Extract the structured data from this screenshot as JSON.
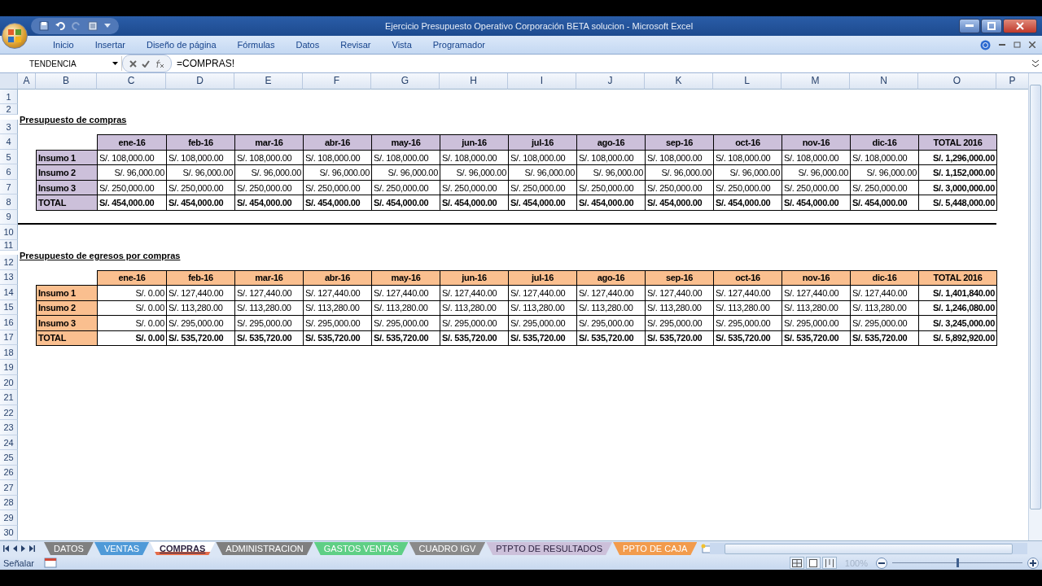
{
  "window": {
    "title": "Ejercicio Presupuesto Operativo Corporación BETA solucion - Microsoft Excel"
  },
  "ribbon_tabs": [
    "Inicio",
    "Insertar",
    "Diseño de página",
    "Fórmulas",
    "Datos",
    "Revisar",
    "Vista",
    "Programador"
  ],
  "formula_bar": {
    "name_box": "TENDENCIA",
    "formula": "=COMPRAS!"
  },
  "column_headers": [
    "A",
    "B",
    "C",
    "D",
    "E",
    "F",
    "G",
    "H",
    "I",
    "J",
    "K",
    "L",
    "M",
    "N",
    "O",
    "P"
  ],
  "row_numbers": [
    "1",
    "2",
    "3",
    "4",
    "5",
    "6",
    "7",
    "8",
    "9",
    "10",
    "11",
    "12",
    "13",
    "14",
    "15",
    "16",
    "17",
    "18",
    "19",
    "20",
    "21",
    "22",
    "23",
    "24",
    "25",
    "26",
    "27",
    "28",
    "29",
    "30"
  ],
  "tables": [
    {
      "title": "Presupuesto de compras",
      "color": "#ccc0da",
      "headers": [
        "ene-16",
        "feb-16",
        "mar-16",
        "abr-16",
        "may-16",
        "jun-16",
        "jul-16",
        "ago-16",
        "sep-16",
        "oct-16",
        "nov-16",
        "dic-16",
        "TOTAL 2016"
      ],
      "rows": [
        {
          "label": "Insumo 1",
          "values": [
            "S/. 108,000.00",
            "S/. 108,000.00",
            "S/. 108,000.00",
            "S/. 108,000.00",
            "S/. 108,000.00",
            "S/. 108,000.00",
            "S/. 108,000.00",
            "S/. 108,000.00",
            "S/. 108,000.00",
            "S/. 108,000.00",
            "S/. 108,000.00",
            "S/. 108,000.00"
          ],
          "total": "S/. 1,296,000.00"
        },
        {
          "label": "Insumo 2",
          "values": [
            "S/. 96,000.00",
            "S/. 96,000.00",
            "S/. 96,000.00",
            "S/. 96,000.00",
            "S/. 96,000.00",
            "S/. 96,000.00",
            "S/. 96,000.00",
            "S/. 96,000.00",
            "S/. 96,000.00",
            "S/. 96,000.00",
            "S/. 96,000.00",
            "S/. 96,000.00"
          ],
          "total": "S/. 1,152,000.00"
        },
        {
          "label": "Insumo 3",
          "values": [
            "S/. 250,000.00",
            "S/. 250,000.00",
            "S/. 250,000.00",
            "S/. 250,000.00",
            "S/. 250,000.00",
            "S/. 250,000.00",
            "S/. 250,000.00",
            "S/. 250,000.00",
            "S/. 250,000.00",
            "S/. 250,000.00",
            "S/. 250,000.00",
            "S/. 250,000.00"
          ],
          "total": "S/. 3,000,000.00"
        }
      ],
      "total_row": {
        "label": "TOTAL",
        "values": [
          "S/. 454,000.00",
          "S/. 454,000.00",
          "S/. 454,000.00",
          "S/. 454,000.00",
          "S/. 454,000.00",
          "S/. 454,000.00",
          "S/. 454,000.00",
          "S/. 454,000.00",
          "S/. 454,000.00",
          "S/. 454,000.00",
          "S/. 454,000.00",
          "S/. 454,000.00"
        ],
        "total": "S/. 5,448,000.00"
      }
    },
    {
      "title": "Presupuesto de egresos por compras",
      "color": "#fabf8f",
      "headers": [
        "ene-16",
        "feb-16",
        "mar-16",
        "abr-16",
        "may-16",
        "jun-16",
        "jul-16",
        "ago-16",
        "sep-16",
        "oct-16",
        "nov-16",
        "dic-16",
        "TOTAL 2016"
      ],
      "rows": [
        {
          "label": "Insumo 1",
          "values": [
            "S/. 0.00",
            "S/. 127,440.00",
            "S/. 127,440.00",
            "S/. 127,440.00",
            "S/. 127,440.00",
            "S/. 127,440.00",
            "S/. 127,440.00",
            "S/. 127,440.00",
            "S/. 127,440.00",
            "S/. 127,440.00",
            "S/. 127,440.00",
            "S/. 127,440.00"
          ],
          "total": "S/. 1,401,840.00"
        },
        {
          "label": "Insumo 2",
          "values": [
            "S/. 0.00",
            "S/. 113,280.00",
            "S/. 113,280.00",
            "S/. 113,280.00",
            "S/. 113,280.00",
            "S/. 113,280.00",
            "S/. 113,280.00",
            "S/. 113,280.00",
            "S/. 113,280.00",
            "S/. 113,280.00",
            "S/. 113,280.00",
            "S/. 113,280.00"
          ],
          "total": "S/. 1,246,080.00"
        },
        {
          "label": "Insumo 3",
          "values": [
            "S/. 0.00",
            "S/. 295,000.00",
            "S/. 295,000.00",
            "S/. 295,000.00",
            "S/. 295,000.00",
            "S/. 295,000.00",
            "S/. 295,000.00",
            "S/. 295,000.00",
            "S/. 295,000.00",
            "S/. 295,000.00",
            "S/. 295,000.00",
            "S/. 295,000.00"
          ],
          "total": "S/. 3,245,000.00"
        }
      ],
      "total_row": {
        "label": "TOTAL",
        "values": [
          "S/. 0.00",
          "S/. 535,720.00",
          "S/. 535,720.00",
          "S/. 535,720.00",
          "S/. 535,720.00",
          "S/. 535,720.00",
          "S/. 535,720.00",
          "S/. 535,720.00",
          "S/. 535,720.00",
          "S/. 535,720.00",
          "S/. 535,720.00",
          "S/. 535,720.00"
        ],
        "total": "S/. 5,892,920.00"
      }
    }
  ],
  "sheet_tabs": [
    {
      "label": "DATOS",
      "selected": false,
      "color": "#808080"
    },
    {
      "label": "VENTAS",
      "selected": false,
      "color": "#4f9ad8"
    },
    {
      "label": "COMPRAS",
      "selected": true,
      "color": "#e46c4a"
    },
    {
      "label": "ADMINISTRACION",
      "selected": false,
      "color": "#7f7f7f"
    },
    {
      "label": "GASTOS VENTAS",
      "selected": false,
      "color": "#5fcf85"
    },
    {
      "label": "CUADRO IGV",
      "selected": false,
      "color": "#8a8a8a"
    },
    {
      "label": "PTPTO DE RESULTADOS",
      "selected": false,
      "color": "#ccc0da"
    },
    {
      "label": "PPTO DE CAJA",
      "selected": false,
      "color": "#f29b4c"
    }
  ],
  "status_bar": {
    "mode": "Señalar",
    "zoom": "100%",
    "zoom_slider": {
      "level": 0.5
    }
  }
}
